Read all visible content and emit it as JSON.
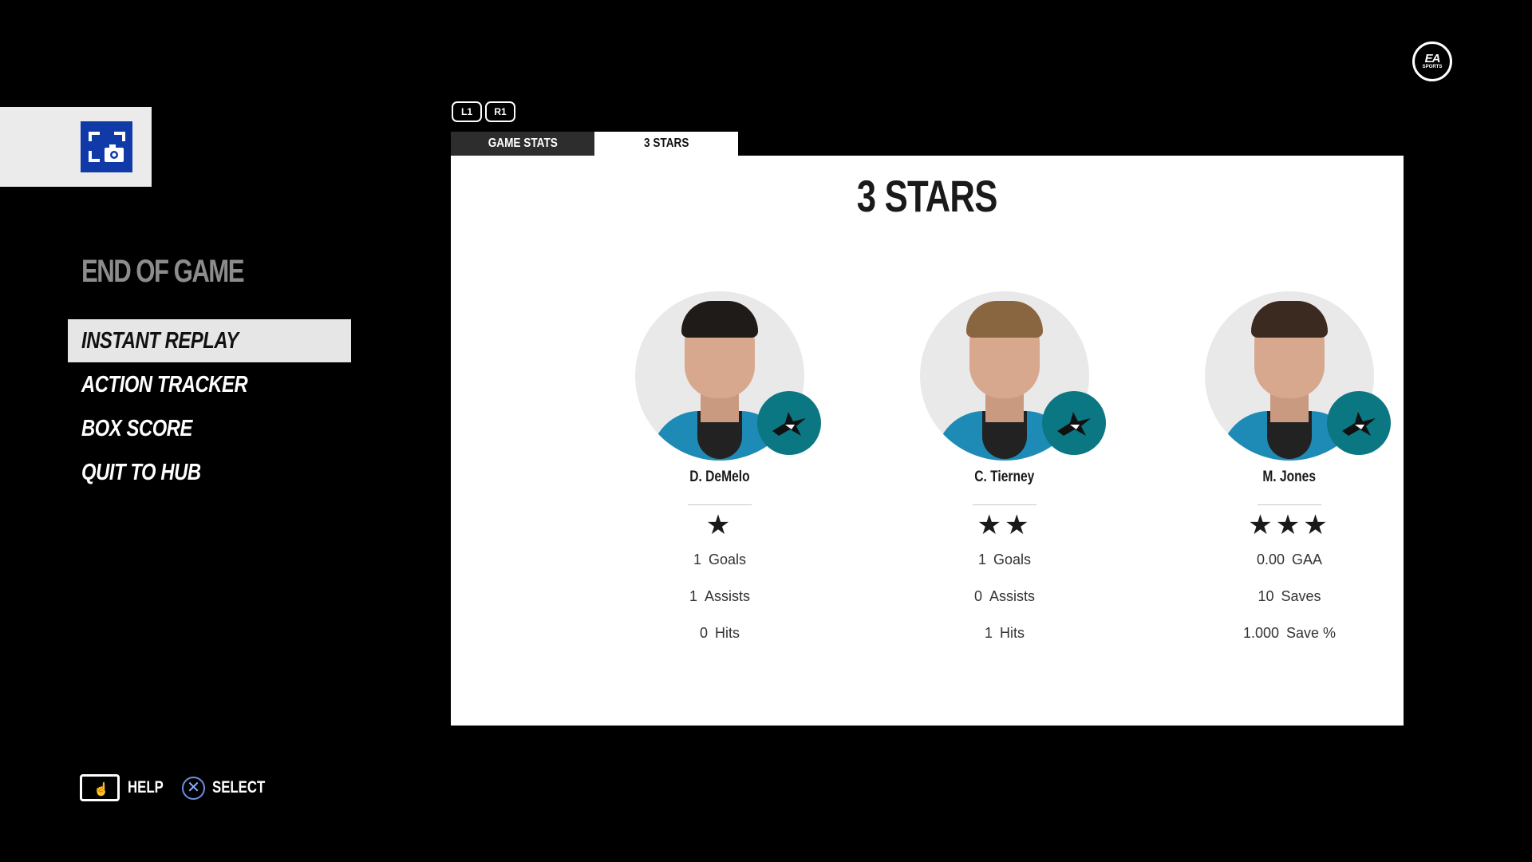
{
  "capture": {
    "icon": "screenshot-camera-icon"
  },
  "brand": {
    "logo_top": "EA",
    "logo_bottom": "SPORTS"
  },
  "menu": {
    "title": "END OF GAME",
    "items": [
      {
        "label": "INSTANT REPLAY",
        "active": true
      },
      {
        "label": "ACTION TRACKER",
        "active": false
      },
      {
        "label": "BOX SCORE",
        "active": false
      },
      {
        "label": "QUIT TO HUB",
        "active": false
      }
    ]
  },
  "shoulders": {
    "left": "L1",
    "right": "R1"
  },
  "tabs": [
    {
      "label": "GAME STATS",
      "active": false
    },
    {
      "label": "3 STARS",
      "active": true
    }
  ],
  "panel": {
    "title": "3 STARS",
    "players": [
      {
        "name": "D. DeMelo",
        "stars": "★",
        "star_count": 1,
        "stats": [
          {
            "value": "1",
            "label": "Goals"
          },
          {
            "value": "1",
            "label": "Assists"
          },
          {
            "value": "0",
            "label": "Hits"
          }
        ]
      },
      {
        "name": "C. Tierney",
        "stars": "★★",
        "star_count": 2,
        "stats": [
          {
            "value": "1",
            "label": "Goals"
          },
          {
            "value": "0",
            "label": "Assists"
          },
          {
            "value": "1",
            "label": "Hits"
          }
        ]
      },
      {
        "name": "M. Jones",
        "stars": "★★★",
        "star_count": 3,
        "stats": [
          {
            "value": "0.00",
            "label": "GAA"
          },
          {
            "value": "10",
            "label": "Saves"
          },
          {
            "value": "1.000",
            "label": "Save %"
          }
        ]
      }
    ]
  },
  "footer": {
    "help_label": "HELP",
    "select_label": "SELECT",
    "help_icon": "touchpad-icon",
    "select_icon": "cross-button-icon"
  },
  "colors": {
    "background": "#000000",
    "capture_blue": "#0f3aa8",
    "team_teal": "#0b7782",
    "jersey_blue": "#1d8bb6"
  }
}
